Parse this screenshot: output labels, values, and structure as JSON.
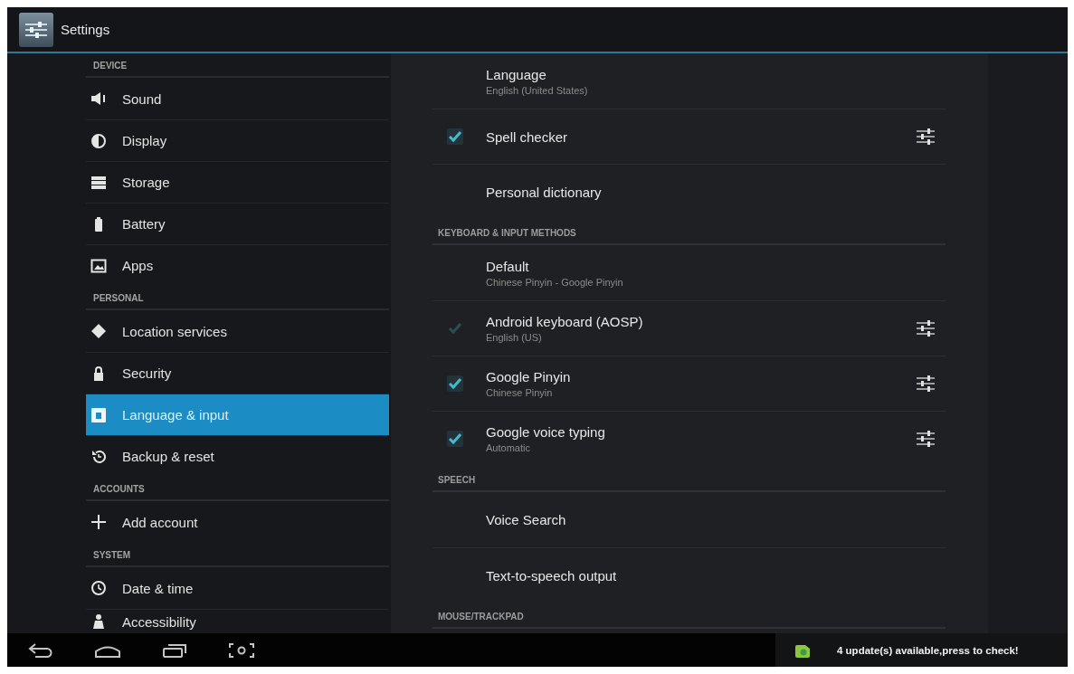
{
  "action_bar": {
    "title": "Settings"
  },
  "sidebar": {
    "sections": [
      {
        "header": "DEVICE",
        "items": [
          {
            "label": "Sound",
            "selected": false
          },
          {
            "label": "Display",
            "selected": false
          },
          {
            "label": "Storage",
            "selected": false
          },
          {
            "label": "Battery",
            "selected": false
          },
          {
            "label": "Apps",
            "selected": false
          }
        ]
      },
      {
        "header": "PERSONAL",
        "items": [
          {
            "label": "Location services",
            "selected": false
          },
          {
            "label": "Security",
            "selected": false
          },
          {
            "label": "Language & input",
            "selected": true
          },
          {
            "label": "Backup & reset",
            "selected": false
          }
        ]
      },
      {
        "header": "ACCOUNTS",
        "items": [
          {
            "label": "Add account",
            "selected": false
          }
        ]
      },
      {
        "header": "SYSTEM",
        "items": [
          {
            "label": "Date & time",
            "selected": false
          },
          {
            "label": "Accessibility",
            "selected": false
          }
        ]
      }
    ]
  },
  "content": {
    "sections": [
      {
        "items": [
          {
            "kind": "plain",
            "title": "Language",
            "subtitle": "English (United States)"
          },
          {
            "kind": "toggle",
            "title": "Spell checker",
            "checked": true,
            "disabled": false
          },
          {
            "kind": "plain",
            "title": "Personal dictionary"
          }
        ]
      },
      {
        "header": "KEYBOARD & INPUT METHODS",
        "items": [
          {
            "kind": "plain",
            "title": "Default",
            "subtitle": "Chinese Pinyin - Google Pinyin"
          },
          {
            "kind": "toggle",
            "title": "Android keyboard (AOSP)",
            "subtitle": "English (US)",
            "checked": true,
            "disabled": true
          },
          {
            "kind": "toggle",
            "title": "Google Pinyin",
            "subtitle": "Chinese Pinyin",
            "checked": true,
            "disabled": false
          },
          {
            "kind": "toggle",
            "title": "Google voice typing",
            "subtitle": "Automatic",
            "checked": true,
            "disabled": false
          }
        ]
      },
      {
        "header": "SPEECH",
        "items": [
          {
            "kind": "plain",
            "title": "Voice Search"
          },
          {
            "kind": "plain",
            "title": "Text-to-speech output"
          }
        ]
      },
      {
        "header": "MOUSE/TRACKPAD"
      }
    ]
  },
  "notification": {
    "text": "4 update(s) available,press to check!"
  }
}
